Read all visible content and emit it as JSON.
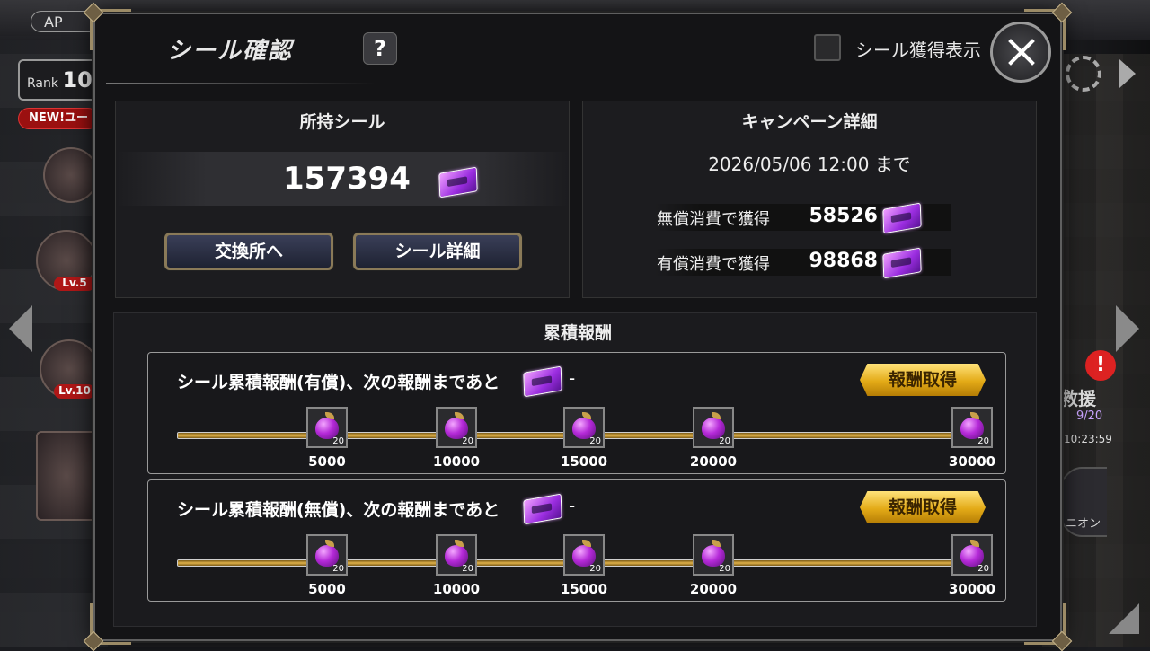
{
  "background": {
    "ap_label": "AP",
    "rank_label": "Rank",
    "rank_value": "10",
    "new_badge": "NEW!ユー",
    "lv_tags": [
      "Lv.5",
      "Lv.10"
    ],
    "rescue_label": "救援",
    "rescue_count": "9/20",
    "rescue_time": "10:23:59",
    "union_label": "ニオン",
    "alert_mark": "!"
  },
  "dialog": {
    "title": "シール確認",
    "help_label": "?",
    "show_acquired_label": "シール獲得表示",
    "owned": {
      "title": "所持シール",
      "value": "157394",
      "exchange_button": "交換所へ",
      "detail_button": "シール詳細"
    },
    "campaign": {
      "title": "キャンペーン詳細",
      "period": "2026/05/06 12:00 まで",
      "free_label": "無償消費で獲得",
      "free_value": "58526",
      "paid_label": "有償消費で獲得",
      "paid_value": "98868"
    },
    "cumulative": {
      "title": "累積報酬",
      "rows": [
        {
          "label": "シール累積報酬(有償)、次の報酬まであと",
          "remaining": "-",
          "claim_button": "報酬取得",
          "milestones": [
            {
              "threshold": "5000",
              "qty": "20",
              "icon": "purple-apple-icon"
            },
            {
              "threshold": "10000",
              "qty": "20",
              "icon": "purple-apple-icon"
            },
            {
              "threshold": "15000",
              "qty": "20",
              "icon": "purple-apple-icon"
            },
            {
              "threshold": "20000",
              "qty": "20",
              "icon": "purple-apple-icon"
            },
            {
              "threshold": "30000",
              "qty": "20",
              "icon": "purple-apple-icon"
            }
          ]
        },
        {
          "label": "シール累積報酬(無償)、次の報酬まであと",
          "remaining": "-",
          "claim_button": "報酬取得",
          "milestones": [
            {
              "threshold": "5000",
              "qty": "20",
              "icon": "purple-apple-icon"
            },
            {
              "threshold": "10000",
              "qty": "20",
              "icon": "purple-apple-icon"
            },
            {
              "threshold": "15000",
              "qty": "20",
              "icon": "purple-apple-icon"
            },
            {
              "threshold": "20000",
              "qty": "20",
              "icon": "purple-apple-icon"
            },
            {
              "threshold": "30000",
              "qty": "20",
              "icon": "purple-apple-icon"
            }
          ]
        }
      ]
    }
  },
  "colors": {
    "accent_gold": "#e3aa17",
    "frame_gold": "#9c8b66",
    "ticket_purple": "#9b2de0"
  }
}
